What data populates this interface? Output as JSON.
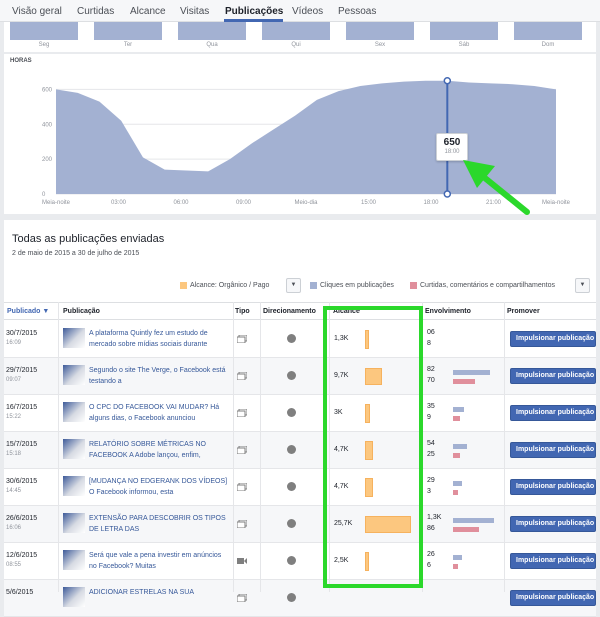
{
  "tabs": [
    {
      "label": "Visão geral",
      "active": false
    },
    {
      "label": "Curtidas",
      "active": false
    },
    {
      "label": "Alcance",
      "active": false
    },
    {
      "label": "Visitas",
      "active": false
    },
    {
      "label": "Publicações",
      "active": true
    },
    {
      "label": "Vídeos",
      "active": false
    },
    {
      "label": "Pessoas",
      "active": false
    }
  ],
  "days": [
    "Seg",
    "Ter",
    "Qua",
    "Qui",
    "Sex",
    "Sáb",
    "Dom"
  ],
  "hours_chart": {
    "title": "HORAS",
    "tooltip_value": "650",
    "tooltip_time": "18:00"
  },
  "chart_data": {
    "type": "area",
    "x": [
      "Meia-noite",
      "01",
      "02",
      "03",
      "04",
      "05",
      "06",
      "07",
      "08",
      "09",
      "10",
      "11",
      "Meio-dia",
      "13",
      "14",
      "15",
      "16",
      "17",
      "18:00",
      "19",
      "20",
      "21",
      "22",
      "23"
    ],
    "x_tick_labels": [
      "Meia-noite",
      "03:00",
      "06:00",
      "09:00",
      "Meio-dia",
      "15:00",
      "18:00",
      "21:00",
      "Meia-noite"
    ],
    "values": [
      600,
      580,
      530,
      420,
      210,
      140,
      135,
      130,
      200,
      290,
      370,
      450,
      540,
      590,
      620,
      635,
      645,
      650,
      650,
      640,
      635,
      630,
      620,
      600
    ],
    "ylim": [
      0,
      700
    ],
    "yticks": [
      0,
      200,
      400,
      600
    ],
    "highlight": {
      "x": "18:00",
      "value": 650
    }
  },
  "panel": {
    "title": "Todas as publicações enviadas",
    "subtitle": "2 de maio de 2015 a 30 de julho de 2015",
    "legend": [
      {
        "label": "Alcance: Orgânico / Pago",
        "color": "#fcc77f"
      },
      {
        "label": "Cliques em publicações",
        "color": "#a3b1d2"
      },
      {
        "label": "Curtidas, comentários e compartilhamentos",
        "color": "#e08f9c"
      }
    ]
  },
  "table": {
    "headers": {
      "published": "Publicado ▼",
      "post": "Publicação",
      "type": "Tipo",
      "targeting": "Direcionamento",
      "reach": "Alcance",
      "engagement": "Envolvimento",
      "promote": "Promover"
    },
    "boost_label": "Impulsionar publicação",
    "rows": [
      {
        "date": "30/7/2015",
        "time": "16:09",
        "text": "A plataforma Quintly fez um estudo de mercado sobre mídias sociais durante",
        "type": "album",
        "reach": "1,3K",
        "reach_value": 1.3,
        "eng_top": "06",
        "eng_bot": "8",
        "clicks": 0,
        "likes": 0
      },
      {
        "date": "29/7/2015",
        "time": "09:07",
        "text": "Segundo o site The Verge, o Facebook está testando a",
        "type": "album",
        "reach": "9,7K",
        "reach_value": 9.7,
        "eng_top": "82",
        "eng_bot": "70",
        "clicks": 0.9,
        "likes": 0.5
      },
      {
        "date": "16/7/2015",
        "time": "15:22",
        "text": "O CPC DO FACEBOOK VAI MUDAR? Há alguns dias, o Facebook anunciou",
        "type": "album",
        "reach": "3K",
        "reach_value": 3.0,
        "eng_top": "35",
        "eng_bot": "9",
        "clicks": 0.2,
        "likes": 0.1
      },
      {
        "date": "15/7/2015",
        "time": "15:18",
        "text": "RELATÓRIO SOBRE MÉTRICAS NO FACEBOOK A Adobe lançou, enfim,",
        "type": "album",
        "reach": "4,7K",
        "reach_value": 4.7,
        "eng_top": "54",
        "eng_bot": "25",
        "clicks": 0.3,
        "likes": 0.1
      },
      {
        "date": "30/6/2015",
        "time": "14:45",
        "text": "[MUDANÇA NO EDGERANK DOS VÍDEOS] O Facebook informou, esta",
        "type": "album",
        "reach": "4,7K",
        "reach_value": 4.7,
        "eng_top": "29",
        "eng_bot": "3",
        "clicks": 0.15,
        "likes": 0.05
      },
      {
        "date": "26/6/2015",
        "time": "16:06",
        "text": "EXTENSÃO PARA DESCOBRIR OS TIPOS DE LETRA DAS",
        "type": "album",
        "reach": "25,7K",
        "reach_value": 25.7,
        "eng_top": "1,3K",
        "eng_bot": "86",
        "clicks": 1.0,
        "likes": 0.6
      },
      {
        "date": "12/6/2015",
        "time": "08:55",
        "text": "Será que vale a pena investir em anúncios no Facebook? Muitas",
        "type": "video",
        "reach": "2,5K",
        "reach_value": 2.5,
        "eng_top": "26",
        "eng_bot": "6",
        "clicks": 0.15,
        "likes": 0.05
      },
      {
        "date": "5/6/2015",
        "time": "",
        "text": "ADICIONAR ESTRELAS NA SUA",
        "type": "album",
        "reach": "",
        "reach_value": 0,
        "eng_top": "",
        "eng_bot": "",
        "clicks": 0,
        "likes": 0
      }
    ]
  },
  "colors": {
    "accent": "#4267b2",
    "highlight_box": "#2bd82b",
    "arrow": "#2bd82b",
    "area": "#a3b1d2",
    "reach": "#fcc77f",
    "clicks": "#a3b1d2",
    "likes": "#e08f9c"
  }
}
